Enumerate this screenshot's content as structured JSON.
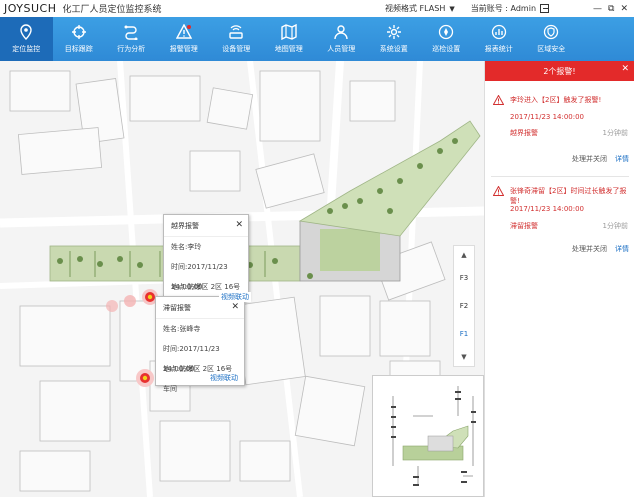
{
  "titlebar": {
    "brand": "JOYSUCH",
    "title": "化工厂人员定位监控系统",
    "video_format": "视频格式 FLASH",
    "account_label": "当前账号 : Admin",
    "window_controls": [
      "—",
      "⧉",
      "✕"
    ]
  },
  "nav": {
    "items": [
      {
        "label": "定位监控",
        "icon": "location-pin-icon",
        "active": true
      },
      {
        "label": "目标跟踪",
        "icon": "crosshair-icon",
        "active": false
      },
      {
        "label": "行为分析",
        "icon": "path-icon",
        "active": false
      },
      {
        "label": "报警管理",
        "icon": "alarm-icon",
        "active": false
      },
      {
        "label": "设备管理",
        "icon": "router-icon",
        "active": false
      },
      {
        "label": "地图管理",
        "icon": "map-icon",
        "active": false
      },
      {
        "label": "人员管理",
        "icon": "person-icon",
        "active": false
      },
      {
        "label": "系统设置",
        "icon": "gear-icon",
        "active": false
      },
      {
        "label": "巡检设置",
        "icon": "patrol-icon",
        "active": false
      },
      {
        "label": "报表统计",
        "icon": "report-icon",
        "active": false
      },
      {
        "label": "区域安全",
        "icon": "shield-icon",
        "active": false
      }
    ]
  },
  "floors": {
    "items": [
      "F3",
      "F2",
      "F1"
    ],
    "active": "F1"
  },
  "popups": {
    "boundary": {
      "title": "越界报警",
      "name": "姓名:李玲",
      "time": "时间:2017/11/23  14:00:00",
      "location": "地点:防爆区 2区 16号车间",
      "link": "视频联动"
    },
    "linger": {
      "title": "滞留报警",
      "name": "姓名:张峰寺",
      "time": "时间:2017/11/23  14:00:00",
      "location": "地点:防爆区 2区 16号车间",
      "link": "视频联动"
    }
  },
  "alarm_panel": {
    "header": "2个报警!",
    "close": "✕",
    "alarms": [
      {
        "message": "李玲进入【2区】触发了报警!",
        "time": "2017/11/23 14:00:00",
        "type": "越界报警",
        "ago": "1分钟前",
        "action": "处理并关闭",
        "detail": "详情"
      },
      {
        "message": "张锋奇滞留【2区】时间过长触发了报警!",
        "time": "2017/11/23 14:00:00",
        "type": "滞留报警",
        "ago": "1分钟前",
        "action": "处理并关闭",
        "detail": "详情"
      }
    ]
  },
  "colors": {
    "nav_bg": "#2f8ad6",
    "nav_active": "#1d6bb8",
    "alarm_red": "#e32a2a",
    "link_blue": "#1b6fc4"
  }
}
